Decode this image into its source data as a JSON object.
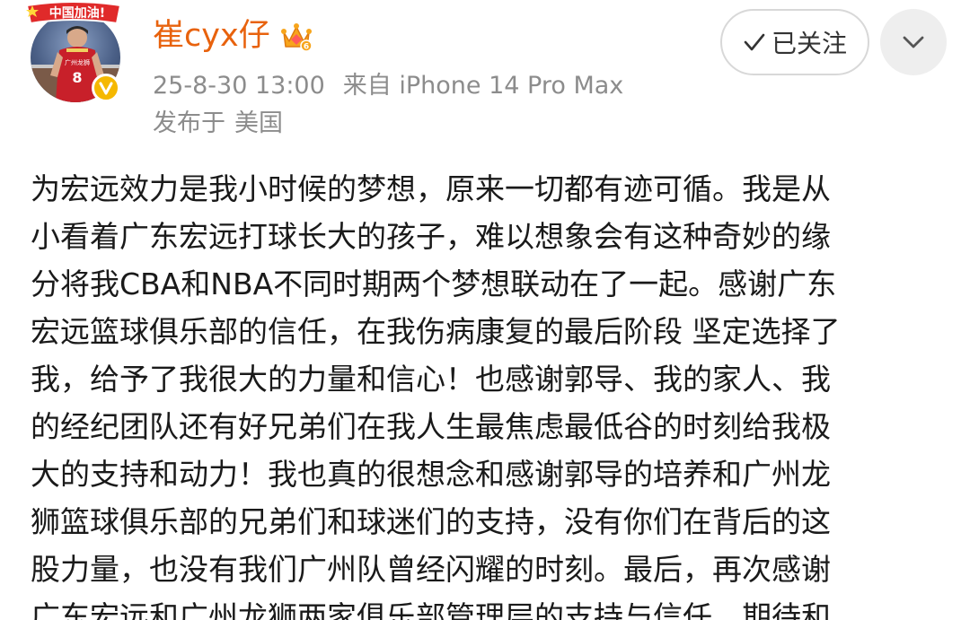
{
  "user": {
    "name": "崔cyx仔",
    "avatar_banner_text": "中国加油!",
    "jersey_number": "8"
  },
  "post_meta": {
    "date_time": "25-8-30 13:00",
    "source": "来自 iPhone 14 Pro Max",
    "location_label": "发布于",
    "location_value": "美国"
  },
  "actions": {
    "follow_label": "已关注"
  },
  "post": {
    "lines": [
      "为宏远效力是我小时候的梦想，原来一切都有迹可循。我是从",
      "小看着广东宏远打球长大的孩子，难以想象会有这种奇妙的缘",
      "分将我CBA和NBA不同时期两个梦想联动在了一起。感谢广东",
      "宏远篮球俱乐部的信任，在我伤病康复的最后阶段 坚定选择了",
      "我，给予了我很大的力量和信心！也感谢郭导、我的家人、我",
      "的经纪团队还有好兄弟们在我人生最焦虑最低谷的时刻给我极",
      "大的支持和动力！我也真的很想念和感谢郭导的培养和广州龙",
      "狮篮球俱乐部的兄弟们和球迷们的支持，没有你们在背后的这",
      "股力量，也没有我们广州队曾经闪耀的时刻。最后，再次感谢",
      "广东宏远和广州龙狮两家俱乐部管理层的支持与信任，期待和"
    ]
  },
  "icons": {
    "verified": "verified-badge-icon",
    "crown": "crown-icon",
    "check": "check-icon",
    "dropdown": "chevron-down-icon"
  },
  "colors": {
    "username": "#e8620d",
    "meta_text": "#8c8c8c",
    "body_text": "#1a1a1a",
    "verified_badge": "#f5b800",
    "more_button_bg": "#eeeeee"
  }
}
